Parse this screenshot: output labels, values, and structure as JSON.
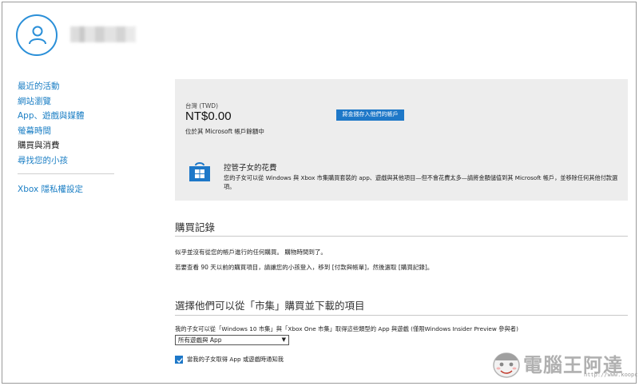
{
  "sidebar": {
    "items": [
      {
        "label": "最近的活動"
      },
      {
        "label": "網站瀏覽"
      },
      {
        "label": "App、遊戲與媒體"
      },
      {
        "label": "螢幕時間"
      },
      {
        "label": "購買與消費"
      },
      {
        "label": "尋找您的小孩"
      }
    ],
    "privacy_label": "Xbox 隱私權設定"
  },
  "balance": {
    "region": "台灣 (TWD)",
    "amount": "NT$0.00",
    "location": "位於其 Microsoft 帳戶餘額中",
    "add_button": "將金錢存入他們的帳戶",
    "promo_title": "控管子女的花費",
    "promo_desc": "您的子女可以從 Windows 與 Xbox 市集購買套裝的 app、遊戲與其他項目—但不會花費太多—請將金額儲值到其 Microsoft 帳戶，並移除任何其他付款選項。"
  },
  "purchase_history": {
    "title": "購買記錄",
    "line1": "似乎並沒有從您的帳戶進行的任何購買。 購物時間到了。",
    "line2": "若要查看 90 天以前的購買項目，請讓您的小孩登入，移到 [付款與帳單]，然後選取 [購買記錄]。"
  },
  "store_settings": {
    "title": "選擇他們可以從「市集」購買並下載的項目",
    "desc": "我的子女可以從「Windows 10 市集」與「Xbox One 市集」取得這些類型的 App 與遊戲 (僅限Windows Insider Preview 參與者)",
    "select_value": "所有遊戲與 App",
    "checkbox_label": "當我的子女取得 App 或遊戲時通知我"
  },
  "watermark": {
    "text": "電腦王阿達",
    "url": "http://www.koopc.com"
  },
  "colors": {
    "accent": "#1e78c8",
    "link": "#1a7ec4",
    "panel": "#ededed"
  }
}
